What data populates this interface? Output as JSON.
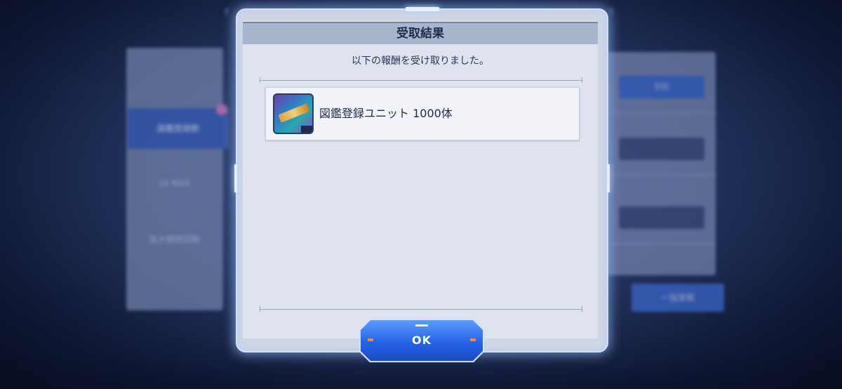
{
  "dialog": {
    "title": "受取結果",
    "message": "以下の報酬を受け取りました。",
    "rewards": [
      {
        "label": "図鑑登録ユニット 1000体",
        "icon": "ticket-item-icon"
      }
    ],
    "ok_label": "OK"
  },
  "background": {
    "left_menu": [
      "図鑑登録数",
      "LV MAX",
      "拡大開放回数"
    ],
    "right_buttons": [
      "受取",
      "",
      ""
    ],
    "bulk_button": "一括受取"
  },
  "colors": {
    "accent": "#2563e6",
    "frame_glow": "#cfe0ff",
    "panel": "#dfe3ee",
    "title_bar": "#a9b5cb"
  }
}
